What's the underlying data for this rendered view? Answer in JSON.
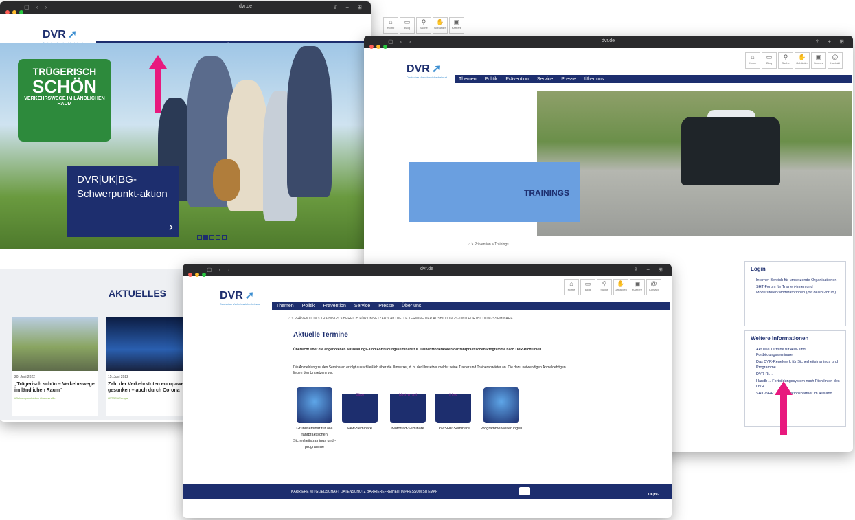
{
  "browser": {
    "url": "dvr.de"
  },
  "dvr": {
    "logo_text": "DVR",
    "logo_sub": "Deutscher Verkehrssicherheitsrat"
  },
  "nav": [
    "Themen",
    "Politik",
    "Prävention",
    "Service",
    "Presse",
    "Über uns"
  ],
  "toolbar": [
    "Home",
    "Blog",
    "Suche",
    "Gebärden",
    "Karriere",
    "Kontakt"
  ],
  "win1": {
    "campaign_sign": {
      "line1": "TRÜGERISCH",
      "line2": "SCHÖN",
      "line3": "VERKEHRSWEGE IM LÄNDLICHEN RAUM"
    },
    "hero_title": "DVR|UK|BG-Schwerpunkt-aktion",
    "aktuelles": "AKTUELLES",
    "cards": [
      {
        "date": "20. Juni 2022",
        "title": "„Trügerisch schön – Verkehrswege im ländlichen Raum“",
        "tags": "#Schwerpunktaktion #Landstraße"
      },
      {
        "date": "15. Juni 2022",
        "title": "Zahl der Verkehrstoten europaweit gesunken – auch durch Corona",
        "tags": "#ETSC #Europa"
      }
    ]
  },
  "win2": {
    "hero_label": "TRAININGS",
    "breadcrumb": "> Prävention > Trainings",
    "login": {
      "title": "Login",
      "items": [
        "Interner Bereich für umsetzende Organisationen",
        "SHT-Forum für Trainer/-innen und Moderatoren/Moderatorinnen (dvr.de/sht-forum)"
      ]
    },
    "weitere": {
      "title": "Weitere Informationen",
      "items": [
        "Aktuelle Termine für Aus- und Fortbildungsseminare",
        "Das DVR-Regelwerk für Sicherheitstrainings und Programme",
        "DVR-Ri…",
        "Handb… Fortbildungssystem nach Richtlinien des DVR",
        "SHT-/SHP… Kooperationspartner im Ausland"
      ]
    }
  },
  "win3": {
    "breadcrumb": "> PRÄVENTION > TRAININGS > BEREICH FÜR UMSETZER > AKTUELLE TERMINE DER AUSBILDUNGS- UND FORTBILDUNGSSEMINARE",
    "heading": "Aktuelle Termine",
    "intro_bold": "Übersicht über die angebotenen Ausbildungs- und Fortbildungsseminare für Trainer/Moderatoren der fahrpraktischen Programme nach DVR-Richtlinien",
    "intro": "Die Anmeldung zu den Seminaren erfolgt ausschließlich über die Umsetzer, d. h. der Umsetzer meldet seine Trainer und Traineranwärter an. Die dazu notwendigen Anmeldebögen liegen den Umsetzern vor.",
    "tiles": [
      {
        "label": "Grundseminar für alle fahrpraktischen Sicherheitstrainings und -programme",
        "badge": ""
      },
      {
        "label": "Pkw-Seminare",
        "badge": "Pkw"
      },
      {
        "label": "Motorrad-Seminare",
        "badge": "Motorrad"
      },
      {
        "label": "Lkw/SHP-Seminare",
        "badge": "Lkw"
      },
      {
        "label": "Programmerweiterungen",
        "badge": ""
      }
    ],
    "footer": "KARRIERE  MITGLIEDSCHAFT  DATENSCHUTZ  BARRIEREFREIHEIT  IMPRESSUM  SITEMAP",
    "footer_brand": "UK|BG"
  },
  "colors": {
    "brand": "#1d2e6e",
    "accent": "#3d8fd1",
    "annotation": "#e8197e"
  }
}
